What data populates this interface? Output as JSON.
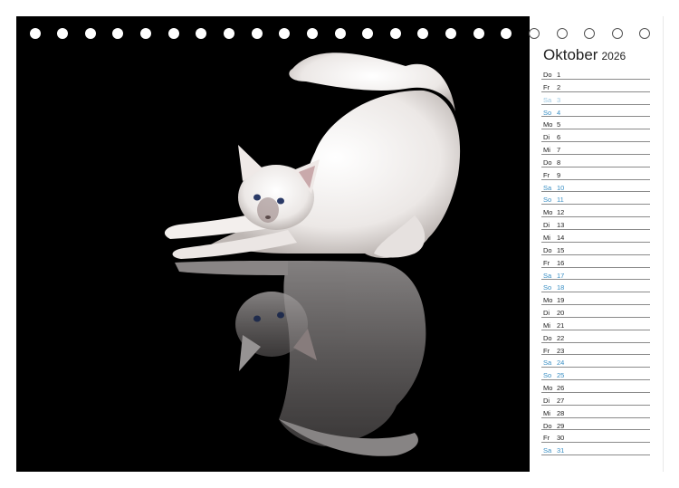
{
  "calendar": {
    "month": "Oktober",
    "year": "2026",
    "days": [
      {
        "wd": "Do",
        "d": "1",
        "we": false
      },
      {
        "wd": "Fr",
        "d": "2",
        "we": false
      },
      {
        "wd": "Sa",
        "d": "3",
        "we": true
      },
      {
        "wd": "So",
        "d": "4",
        "we": true
      },
      {
        "wd": "Mo",
        "d": "5",
        "we": false
      },
      {
        "wd": "Di",
        "d": "6",
        "we": false
      },
      {
        "wd": "Mi",
        "d": "7",
        "we": false
      },
      {
        "wd": "Do",
        "d": "8",
        "we": false
      },
      {
        "wd": "Fr",
        "d": "9",
        "we": false
      },
      {
        "wd": "Sa",
        "d": "10",
        "we": true
      },
      {
        "wd": "So",
        "d": "11",
        "we": true
      },
      {
        "wd": "Mo",
        "d": "12",
        "we": false
      },
      {
        "wd": "Di",
        "d": "13",
        "we": false
      },
      {
        "wd": "Mi",
        "d": "14",
        "we": false
      },
      {
        "wd": "Do",
        "d": "15",
        "we": false
      },
      {
        "wd": "Fr",
        "d": "16",
        "we": false
      },
      {
        "wd": "Sa",
        "d": "17",
        "we": true
      },
      {
        "wd": "So",
        "d": "18",
        "we": true
      },
      {
        "wd": "Mo",
        "d": "19",
        "we": false
      },
      {
        "wd": "Di",
        "d": "20",
        "we": false
      },
      {
        "wd": "Mi",
        "d": "21",
        "we": false
      },
      {
        "wd": "Do",
        "d": "22",
        "we": false
      },
      {
        "wd": "Fr",
        "d": "23",
        "we": false
      },
      {
        "wd": "Sa",
        "d": "24",
        "we": true
      },
      {
        "wd": "So",
        "d": "25",
        "we": true
      },
      {
        "wd": "Mo",
        "d": "26",
        "we": false
      },
      {
        "wd": "Di",
        "d": "27",
        "we": false
      },
      {
        "wd": "Mi",
        "d": "28",
        "we": false
      },
      {
        "wd": "Do",
        "d": "29",
        "we": false
      },
      {
        "wd": "Fr",
        "d": "30",
        "we": false
      },
      {
        "wd": "Sa",
        "d": "31",
        "we": true
      }
    ]
  },
  "colors": {
    "photo_background": "#000000",
    "weekend": "#3a8fc4",
    "rule_line": "#8a8a8a"
  },
  "photo": {
    "subject": "white-kitten-stretching-with-reflection"
  }
}
